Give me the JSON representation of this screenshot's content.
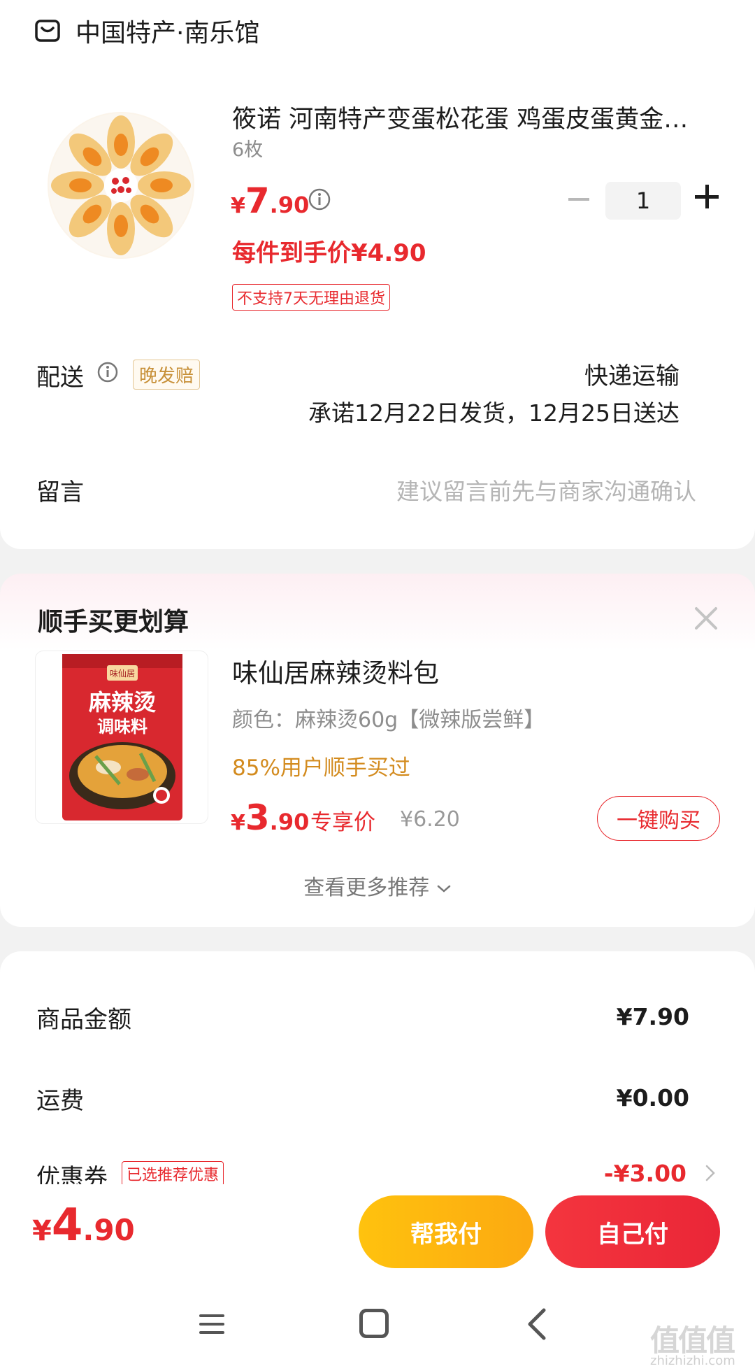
{
  "shop": {
    "name": "中国特产·南乐馆",
    "icon": "shop-icon"
  },
  "product": {
    "title": "筱诺 河南特产变蛋松花蛋 鸡蛋皮蛋黄金…",
    "spec": "6枚",
    "price_symbol": "¥",
    "price_int": "7",
    "price_dec": ".90",
    "quantity": "1",
    "unit_price": "每件到手价¥4.90",
    "no_return_tag": "不支持7天无理由退货"
  },
  "shipping": {
    "label": "配送",
    "late_tag": "晚发赔",
    "method": "快递运输",
    "promise": "承诺12月22日发货，12月25日送达"
  },
  "message": {
    "label": "留言",
    "placeholder": "建议留言前先与商家沟通确认"
  },
  "recommend": {
    "title": "顺手买更划算",
    "product_name": "味仙居麻辣烫料包",
    "attribute": "颜色：麻辣烫60g【微辣版尝鲜】",
    "social_proof": "85%用户顺手买过",
    "price_symbol": "¥",
    "price_int": "3",
    "price_dec": ".90",
    "exclusive_label": "专享价",
    "original_price": "¥6.20",
    "buy_button": "一键购买",
    "more_label": "查看更多推荐",
    "package_brand": "味仙居",
    "package_line1": "麻辣烫",
    "package_line2": "调味料"
  },
  "summary": {
    "goods_label": "商品金额",
    "goods_value": "¥7.90",
    "freight_label": "运费",
    "freight_value": "¥0.00",
    "coupon_label": "优惠券",
    "coupon_tag": "已选推荐优惠",
    "coupon_value": "-¥3.00"
  },
  "bottom": {
    "total_symbol": "¥",
    "total_int": "4",
    "total_dec": ".90",
    "help_pay": "帮我付",
    "self_pay": "自己付"
  },
  "watermark": {
    "text": "值值值",
    "sub": "zhizhizhi.com"
  },
  "colors": {
    "accent_red": "#e8292e",
    "gold": "#fca911",
    "orange_text": "#d38b1e"
  }
}
